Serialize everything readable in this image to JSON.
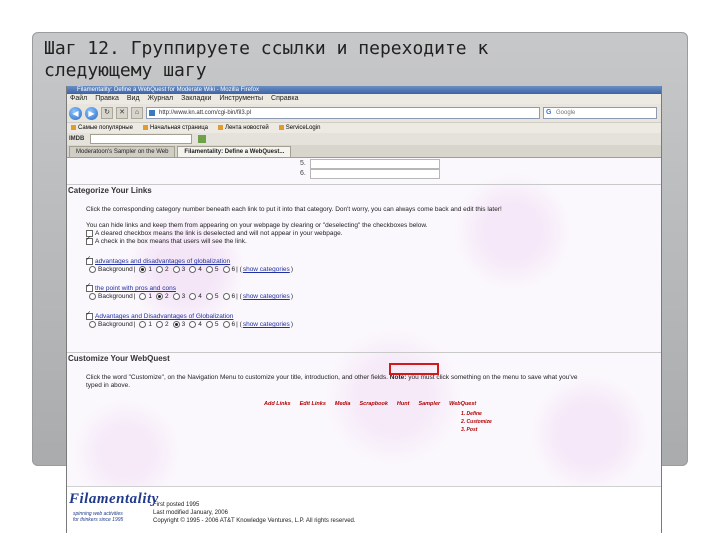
{
  "slide": {
    "title_line1": "Шаг 12. Группируете ссылки и переходите к",
    "title_line2": "следующему шагу"
  },
  "browser": {
    "titlebar": "Filamentality: Define a WebQuest for Moderate Wiki - Mozilla Firefox",
    "menu": [
      "Файл",
      "Правка",
      "Вид",
      "Журнал",
      "Закладки",
      "Инструменты",
      "Справка"
    ],
    "address": "http://www.kn.att.com/cgi-bin/fil3.pl",
    "search_placeholder": "Google",
    "bookmarks": [
      "Самые популярные",
      "Начальная страница",
      "Лента новостей",
      "ServiceLogin"
    ],
    "toolbar_label": "IMDB",
    "tabs": [
      {
        "label": "Moderatoon's Sampler on the Web"
      },
      {
        "label": "Filamentality: Define a WebQuest..."
      }
    ]
  },
  "page": {
    "prev_rows": [
      "5.",
      "6."
    ],
    "categorize": {
      "heading": "Categorize Your Links",
      "intro": "Click the corresponding category number beneath each link to put it into that category. Don't worry, you can always come back and edit this later!",
      "hide_info": "You can hide links and keep them from appearing on your webpage by clearing or \"deselecting\" the checkboxes below.",
      "cleared_info": "A cleared checkbox means the link is deselected and will not appear in your webpage.",
      "checked_info": "A check in the box means that users will see the link.",
      "links": [
        {
          "title": "advantages and disadvantages of globalization",
          "selected": 1
        },
        {
          "title": "the point with pros and cons",
          "selected": 2
        },
        {
          "title": "Advantages and Disadvantages of Globalization",
          "selected": 3
        }
      ],
      "radio_labels": [
        "Background",
        "1",
        "2",
        "3",
        "4",
        "5",
        "6"
      ],
      "show_categories": "show categories"
    },
    "customize": {
      "heading": "Customize Your WebQuest",
      "text1": "Click the word \"Customize\", on the Navigation Menu to customize your title, introduction, and other fields.",
      "note_label": "Note:",
      "text2": "you must click something on the menu to save what you've",
      "text3": "typed in above.",
      "nav_menu": [
        "Add Links",
        "Edit Links",
        "Media",
        "Scrapbook",
        "Hunt",
        "Sampler",
        "WebQuest"
      ],
      "submenu": [
        "1. Define",
        "2. Customize",
        "3. Post"
      ]
    },
    "footer": {
      "logo": "Filamentality",
      "tagline1": "spinning web activities",
      "tagline2": "for thinkers since 1995",
      "line1": "First posted 1995",
      "line2": "Last modified January, 2006",
      "line3": "Copyright © 1995 - 2006 AT&T Knowledge Ventures, L.P. All rights reserved."
    }
  }
}
